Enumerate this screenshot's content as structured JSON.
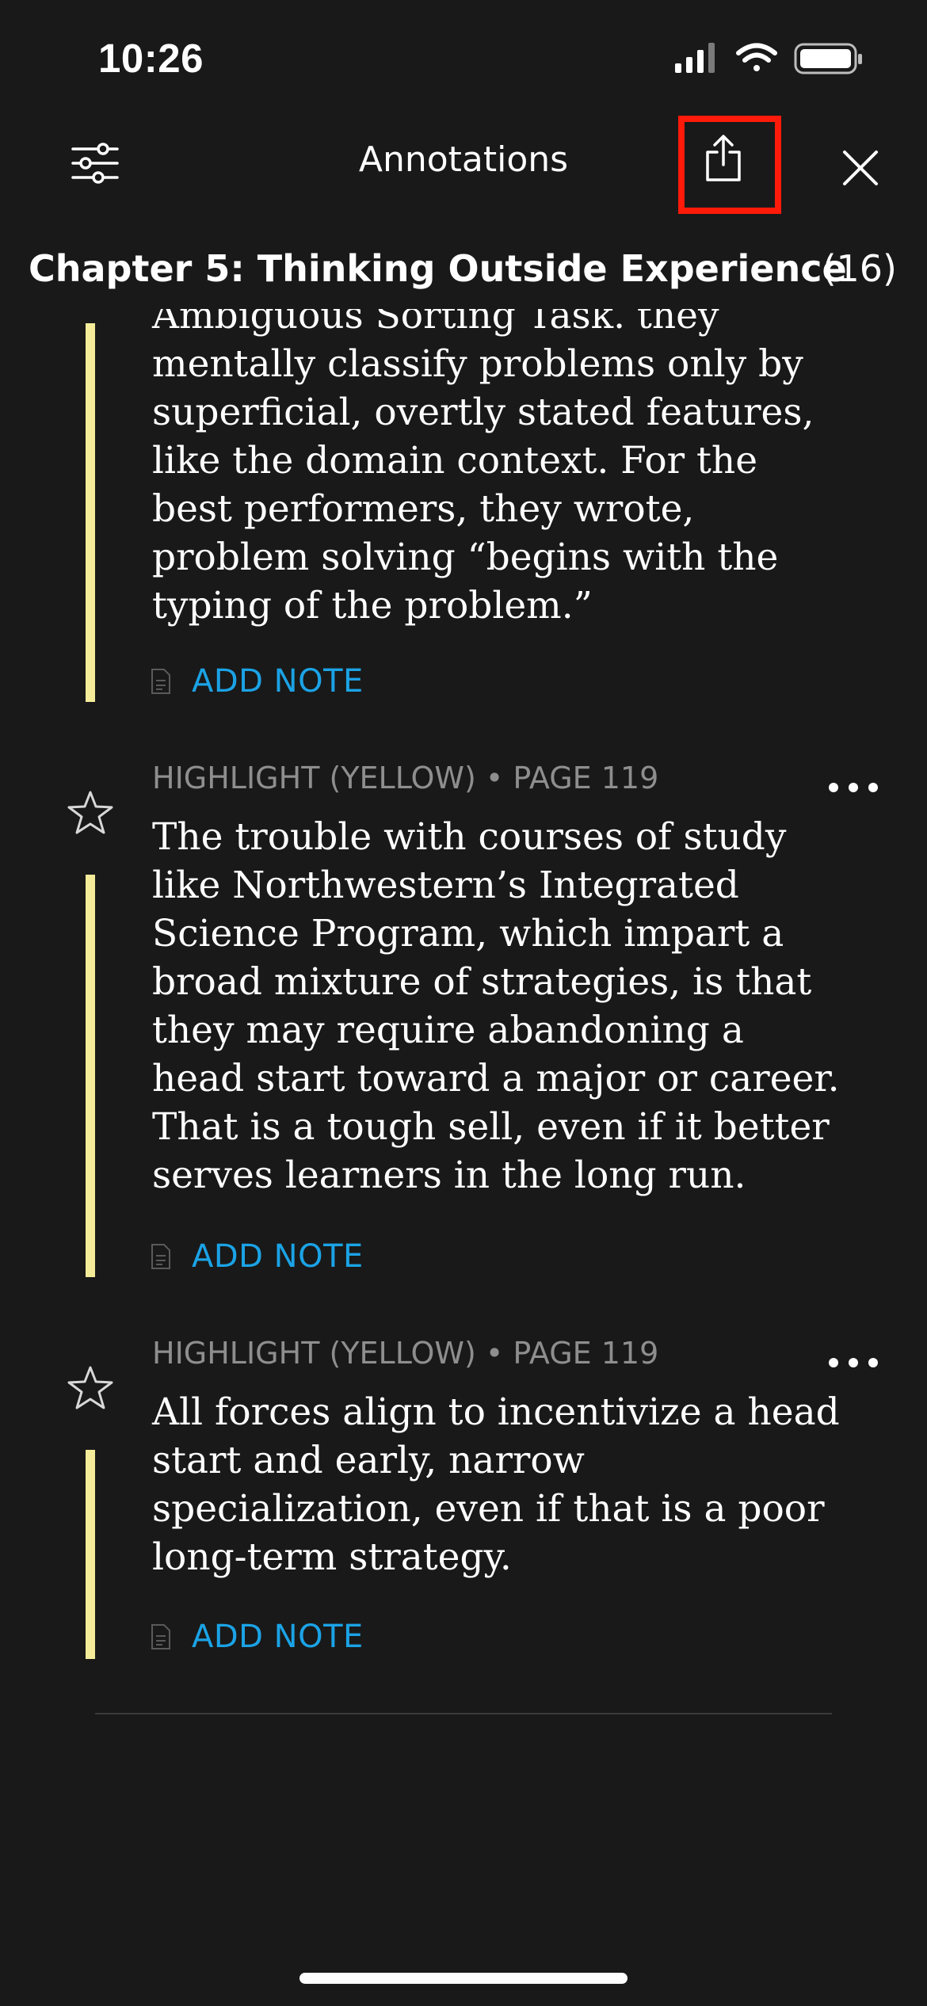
{
  "status_bar": {
    "time": "10:26"
  },
  "header": {
    "title": "Annotations",
    "icons": [
      "filter-sliders-icon",
      "share-icon",
      "close-icon"
    ],
    "highlight_color": "#ff1a0a"
  },
  "chapter": {
    "title": "Chapter 5: Thinking Outside Experience",
    "count": "(16)"
  },
  "annotations": [
    {
      "meta": "",
      "lines": [
        "Ambiguous Sorting Task. they",
        "mentally classify problems only by",
        "superficial, overtly stated features,",
        "like the domain context. For the",
        "best performers, they wrote,",
        "problem solving “begins with the",
        "typing of the problem.”"
      ],
      "add_note": "ADD NOTE"
    },
    {
      "meta": "HIGHLIGHT (YELLOW) • PAGE 119",
      "lines": [
        "The trouble with courses of study",
        "like Northwestern’s Integrated",
        "Science Program, which impart a",
        "broad mixture of strategies, is that",
        "they may require abandoning a",
        "head start toward a major or career.",
        "That is a tough sell, even if it better",
        "serves learners in the long run."
      ],
      "add_note": "ADD NOTE"
    },
    {
      "meta": "HIGHLIGHT (YELLOW) • PAGE 119",
      "lines": [
        "All forces align to incentivize a head",
        "start and early, narrow",
        "specialization, even if that is a poor",
        "long-term strategy."
      ],
      "add_note": "ADD NOTE"
    }
  ],
  "colors": {
    "background": "#191919",
    "highlight_yellow": "#f5ec9a",
    "link_blue": "#1ba3e6",
    "meta_gray": "#8e8e8e"
  }
}
